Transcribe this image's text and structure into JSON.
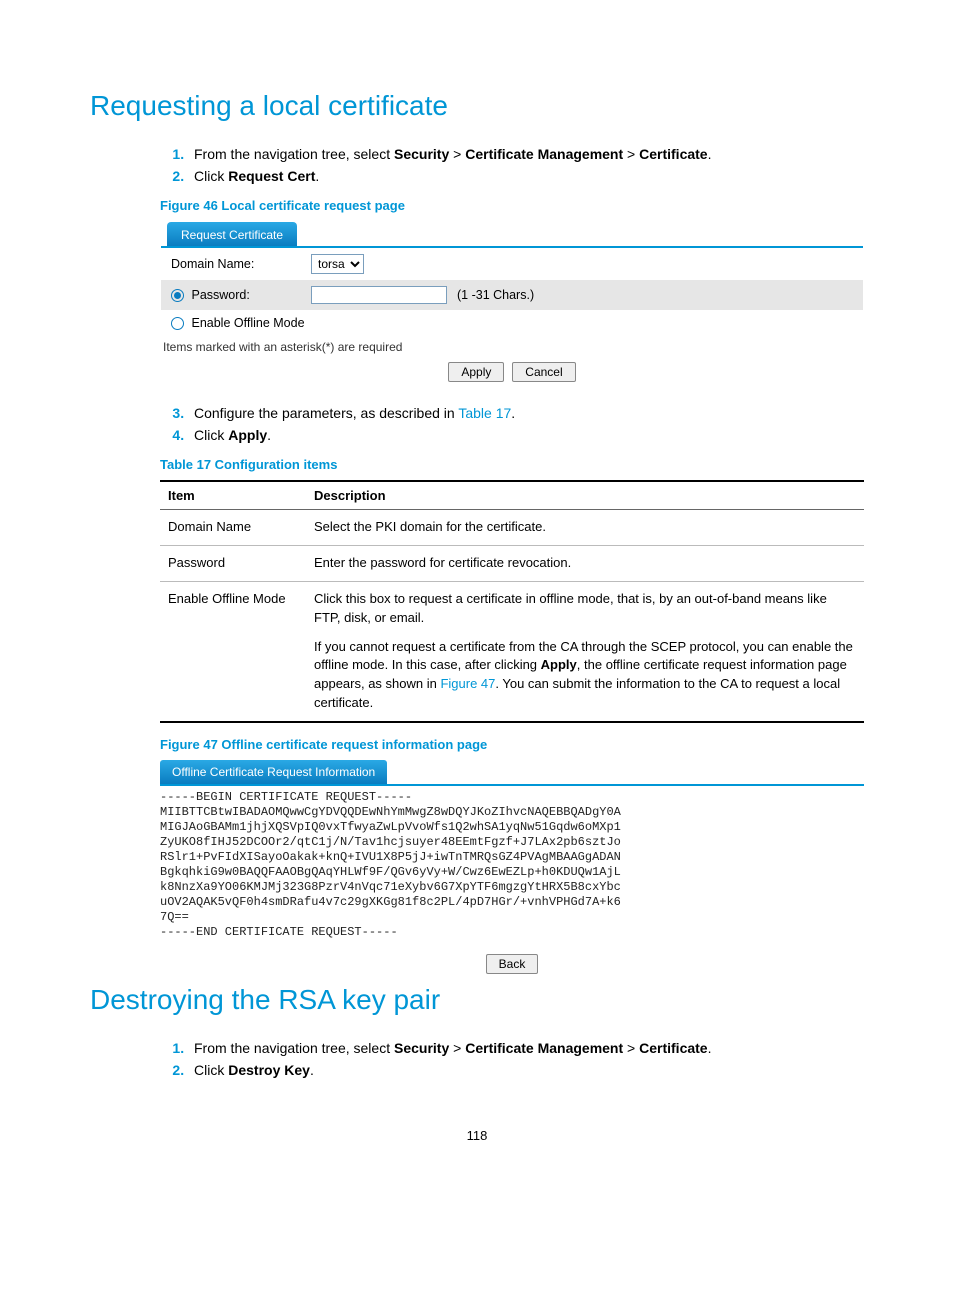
{
  "page_number": "118",
  "section1": {
    "title": "Requesting a local certificate",
    "step1_pre": "From the navigation tree, select ",
    "step1_b1": "Security",
    "step1_gt": " > ",
    "step1_b2": "Certificate Management",
    "step1_b3": "Certificate",
    "step1_post": ".",
    "step2_pre": "Click ",
    "step2_b": "Request Cert",
    "step2_post": ".",
    "step3_pre": "Configure the parameters, as described in ",
    "step3_link": "Table 17",
    "step3_post": ".",
    "step4_pre": "Click ",
    "step4_b": "Apply",
    "step4_post": "."
  },
  "fig46": {
    "caption": "Figure 46 Local certificate request page",
    "tab": "Request Certificate",
    "row_domain_label": "Domain Name:",
    "row_domain_value": "torsa",
    "row_password_label": "Password:",
    "row_password_hint": "(1 -31 Chars.)",
    "row_offline_label": "Enable Offline Mode",
    "required_hint": "Items marked with an asterisk(*) are required",
    "btn_apply": "Apply",
    "btn_cancel": "Cancel"
  },
  "table17": {
    "caption": "Table 17 Configuration items",
    "head_item": "Item",
    "head_desc": "Description",
    "r1_item": "Domain Name",
    "r1_desc": "Select the PKI domain for the certificate.",
    "r2_item": "Password",
    "r2_desc": "Enter the password for certificate revocation.",
    "r3_item": "Enable Offline Mode",
    "r3_p1": "Click this box to request a certificate in offline mode, that is, by an out-of-band means like FTP, disk, or email.",
    "r3_p2_a": "If you cannot request a certificate from the CA through the SCEP protocol, you can enable the offline mode. In this case, after clicking ",
    "r3_p2_b": "Apply",
    "r3_p2_c": ", the offline certificate request information page appears, as shown in ",
    "r3_p2_link": "Figure 47",
    "r3_p2_d": ". You can submit the information to the CA to request a local certificate."
  },
  "fig47": {
    "caption": "Figure 47 Offline certificate request information page",
    "tab": "Offline Certificate Request Information",
    "cert": "-----BEGIN CERTIFICATE REQUEST-----\nMIIBTTCBtwIBADAOMQwwCgYDVQQDEwNhYmMwgZ8wDQYJKoZIhvcNAQEBBQADgY0A\nMIGJAoGBAMm1jhjXQSVpIQ0vxTfwyaZwLpVvoWfs1Q2whSA1yqNw51Gqdw6oMXp1\nZyUKO8fIHJ52DCOOr2/qtC1j/N/Tav1hcjsuyer48EEmtFgzf+J7LAx2pb6sztJo\nRSlr1+PvFIdXISayoOakak+knQ+IVU1X8P5jJ+iwTnTMRQsGZ4PVAgMBAAGgADAN\nBgkqhkiG9w0BAQQFAAOBgQAqYHLWf9F/QGv6yVy+W/Cwz6EwEZLp+h0KDUQw1AjL\nk8NnzXa9YO06KMJMj323G8PzrV4nVqc71eXybv6G7XpYTF6mgzgYtHRX5B8cxYbc\nuOV2AQAK5vQF0h4smDRafu4v7c29gXKGg81f8c2PL/4pD7HGr/+vnhVPHGd7A+k6\n7Q==\n-----END CERTIFICATE REQUEST-----",
    "btn_back": "Back"
  },
  "section2": {
    "title": "Destroying the RSA key pair",
    "step1_pre": "From the navigation tree, select ",
    "step1_b1": "Security",
    "step1_gt": " > ",
    "step1_b2": "Certificate Management",
    "step1_b3": "Certificate",
    "step1_post": ".",
    "step2_pre": "Click ",
    "step2_b": "Destroy Key",
    "step2_post": "."
  }
}
